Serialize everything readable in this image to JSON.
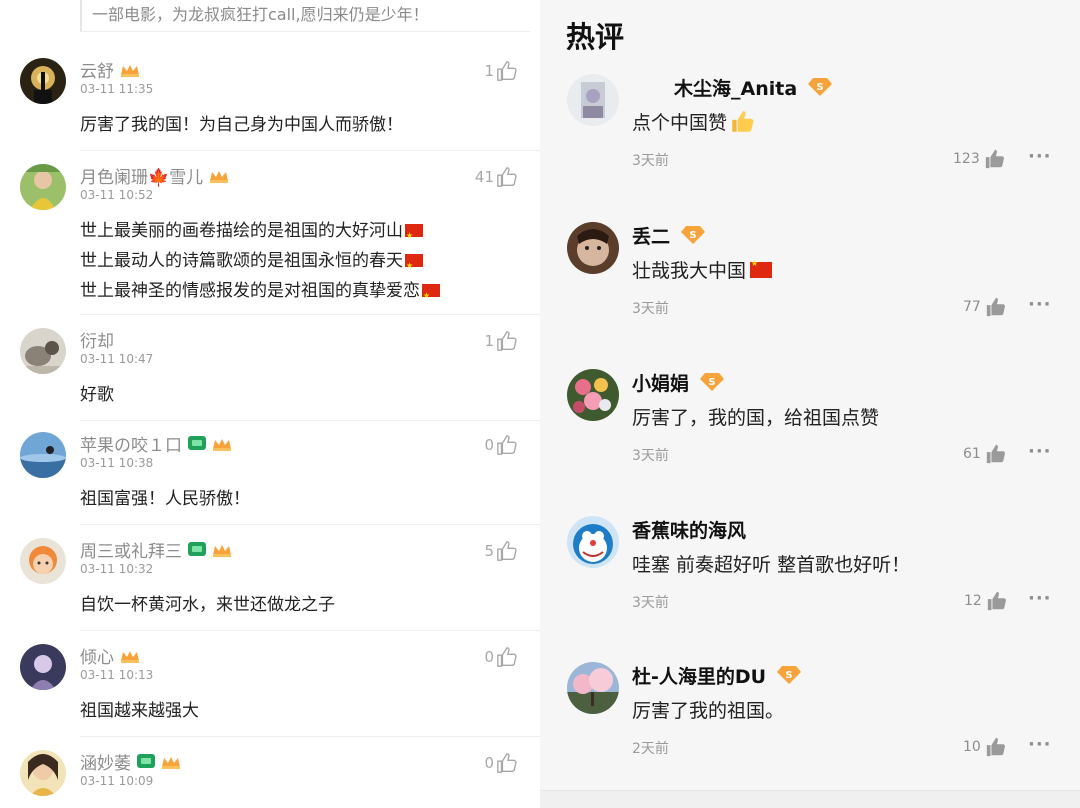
{
  "left": {
    "top_quote": "一部电影，为龙叔疯狂打call,愿归来仍是少年！",
    "comments": [
      {
        "name": "云舒",
        "time": "03-11 11:35",
        "likes": "1",
        "lines": [
          "厉害了我的国！为自己身为中国人而骄傲！"
        ]
      },
      {
        "name": "月色阑珊🍁雪儿",
        "time": "03-11 10:52",
        "likes": "41",
        "lines": [
          "世上最美丽的画卷描绘的是祖国的大好河山",
          "世上最动人的诗篇歌颂的是祖国永恒的春天",
          "世上最神圣的情感报发的是对祖国的真挚爱恋"
        ]
      },
      {
        "name": "衍却",
        "time": "03-11 10:47",
        "likes": "1",
        "lines": [
          "好歌"
        ]
      },
      {
        "name": "苹果の咬１口",
        "time": "03-11 10:38",
        "likes": "0",
        "lines": [
          "祖国富强！人民骄傲！"
        ]
      },
      {
        "name": "周三或礼拜三",
        "time": "03-11 10:32",
        "likes": "5",
        "lines": [
          "自饮一杯黄河水，来世还做龙之子"
        ]
      },
      {
        "name": "倾心",
        "time": "03-11 10:13",
        "likes": "0",
        "lines": [
          "祖国越来越强大"
        ]
      },
      {
        "name": "涵妙萎",
        "time": "03-11 10:09",
        "likes": "0",
        "lines": []
      }
    ]
  },
  "right": {
    "title": "热评",
    "comments": [
      {
        "name": "木尘海_Anita",
        "text": "点个中国赞",
        "time": "3天前",
        "likes": "123"
      },
      {
        "name": "丢二",
        "text": "壮哉我大中国",
        "time": "3天前",
        "likes": "77"
      },
      {
        "name": "小娟娟",
        "text": "厉害了，我的国，给祖国点赞",
        "time": "3天前",
        "likes": "61"
      },
      {
        "name": "香蕉味的海风",
        "text": "哇塞 前奏超好听 整首歌也好听！",
        "time": "3天前",
        "likes": "12"
      },
      {
        "name": "杜-人海里的DU",
        "text": "厉害了我的祖国。",
        "time": "2天前",
        "likes": "10"
      }
    ],
    "more_label": "···"
  },
  "colors": {
    "accent_orange": "#f5a33a",
    "flag_red": "#de2910",
    "badge_green": "#1fa15a"
  },
  "icons": {
    "like": "thumbs-up-icon",
    "vip": "crown-icon",
    "level": "s-badge-icon",
    "more": "more-dots-icon"
  }
}
